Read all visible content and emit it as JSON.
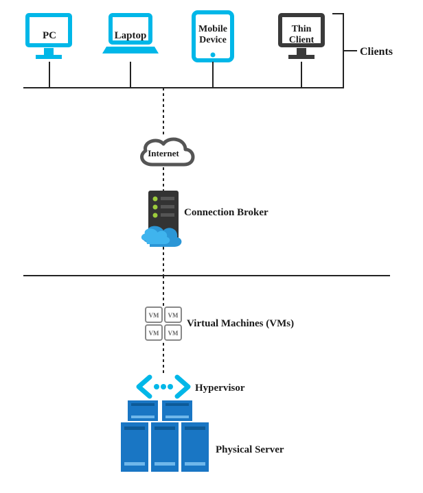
{
  "clients": {
    "section_label": "Clients",
    "devices": [
      {
        "id": "pc",
        "label": "PC"
      },
      {
        "id": "laptop",
        "label": "Laptop"
      },
      {
        "id": "mobile",
        "label": "Mobile\nDevice"
      },
      {
        "id": "thin",
        "label": "Thin\nClient"
      }
    ]
  },
  "internet": {
    "label": "Internet"
  },
  "broker": {
    "label": "Connection Broker"
  },
  "vms": {
    "label": "Virtual Machines (VMs)",
    "box_text": "VM"
  },
  "hypervisor": {
    "label": "Hypervisor"
  },
  "server": {
    "label": "Physical Server"
  },
  "colors": {
    "cyan": "#00b7e8",
    "dark": "#3a3a3a",
    "blue": "#1976c4",
    "blue_light": "#39a0e8",
    "gray": "#888888",
    "line": "#222222"
  }
}
